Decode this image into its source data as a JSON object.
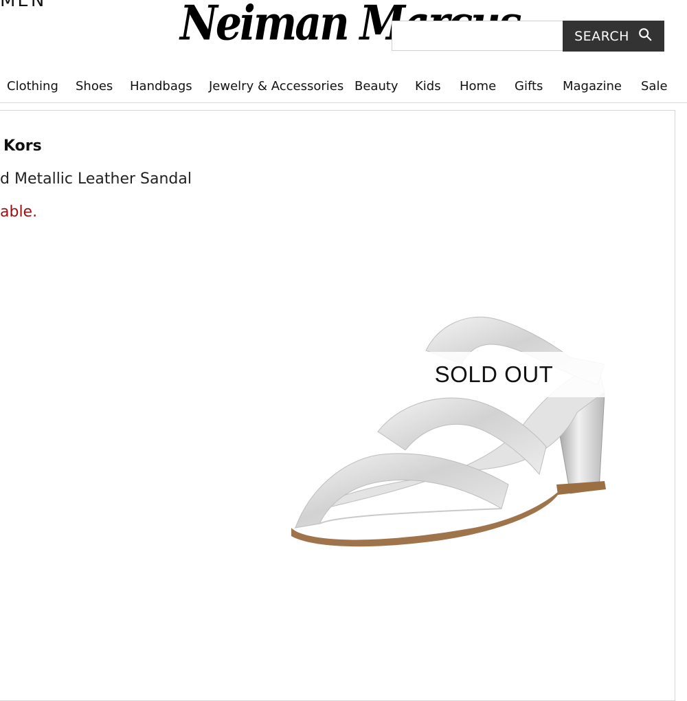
{
  "header": {
    "top_left_text": "MEN",
    "logo_text": "Neiman Marcus",
    "search": {
      "value": "",
      "placeholder": "",
      "button_label": "SEARCH"
    }
  },
  "nav": {
    "items": [
      {
        "label": "Clothing"
      },
      {
        "label": "Shoes"
      },
      {
        "label": "Handbags"
      },
      {
        "label": "Jewelry & Accessories"
      },
      {
        "label": "Beauty"
      },
      {
        "label": "Kids"
      },
      {
        "label": "Home"
      },
      {
        "label": "Gifts"
      },
      {
        "label": "Magazine"
      },
      {
        "label": "Sale"
      }
    ]
  },
  "product": {
    "brand": "Kors",
    "name": "d Metallic Leather Sandal",
    "availability": "able.",
    "image_icon": "sandal-image",
    "overlay_label": "SOLD OUT"
  },
  "colors": {
    "search_button_bg": "#333333",
    "availability_text": "#9a1010",
    "border": "#d6d6d6"
  }
}
